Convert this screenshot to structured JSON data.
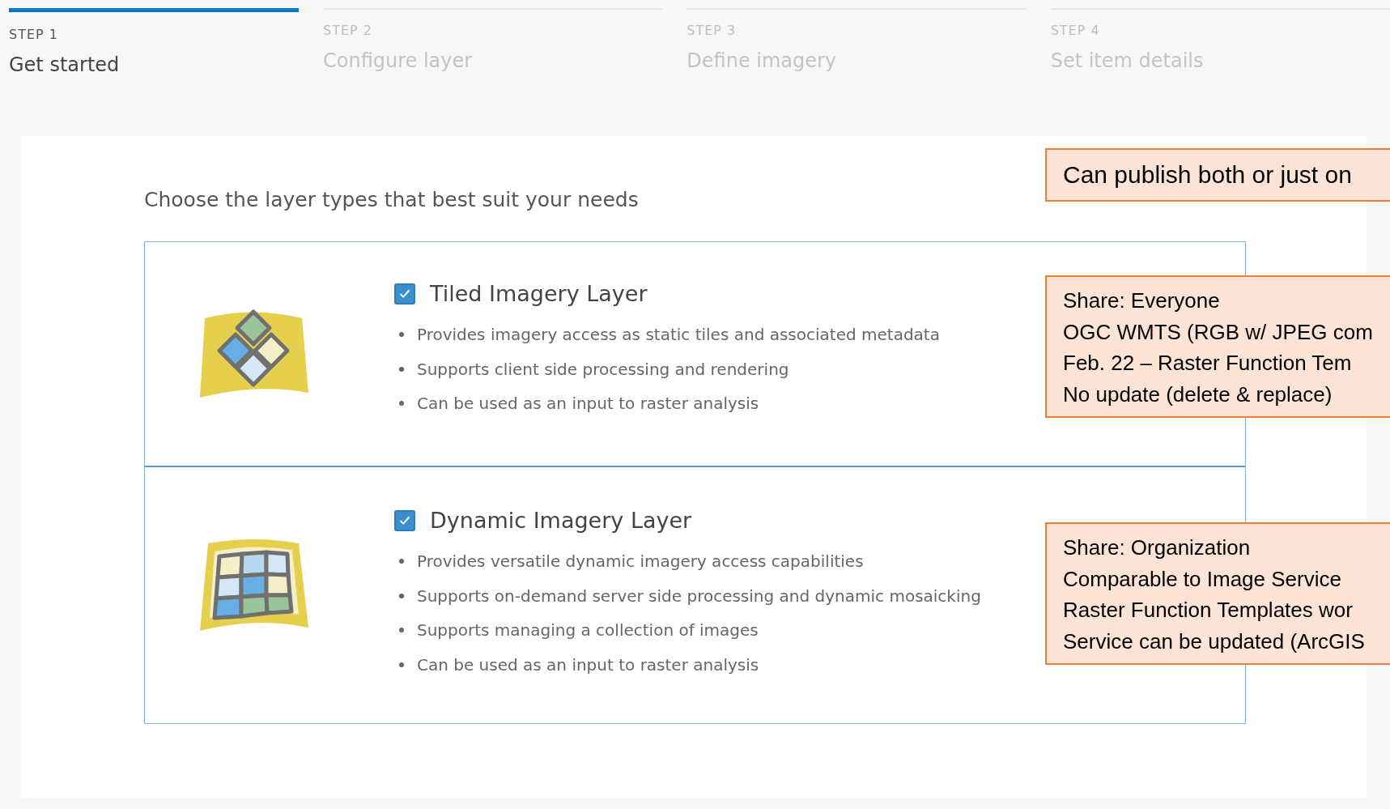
{
  "steps": [
    {
      "label": "STEP 1",
      "title": "Get started",
      "selected": true
    },
    {
      "label": "STEP 2",
      "title": "Configure layer",
      "selected": false
    },
    {
      "label": "STEP 3",
      "title": "Define imagery",
      "selected": false
    },
    {
      "label": "STEP 4",
      "title": "Set item details",
      "selected": false
    }
  ],
  "heading": "Choose the layer types that best suit your needs",
  "layer_types": [
    {
      "kind": "tiled",
      "title": "Tiled Imagery Layer",
      "checked": true,
      "bullets": [
        "Provides imagery access as static tiles and associated metadata",
        "Supports client side processing and rendering",
        "Can be used as an input to raster analysis"
      ]
    },
    {
      "kind": "dynamic",
      "title": "Dynamic Imagery Layer",
      "checked": true,
      "bullets": [
        "Provides versatile dynamic imagery access capabilities",
        "Supports on-demand server side processing and dynamic mosaicking",
        "Supports managing a collection of images",
        "Can be used as an input to raster analysis"
      ]
    }
  ],
  "callouts": [
    {
      "kind": "headline",
      "lines": [
        "Can publish both or just on"
      ]
    },
    {
      "kind": "note",
      "lines": [
        "Share: Everyone",
        "OGC WMTS (RGB w/ JPEG com",
        "Feb. 22 – Raster Function Tem",
        "No update (delete & replace)"
      ]
    },
    {
      "kind": "note",
      "lines": [
        "Share: Organization",
        "Comparable to Image Service",
        "Raster Function Templates wor",
        "Service can be updated (ArcGIS"
      ]
    }
  ]
}
